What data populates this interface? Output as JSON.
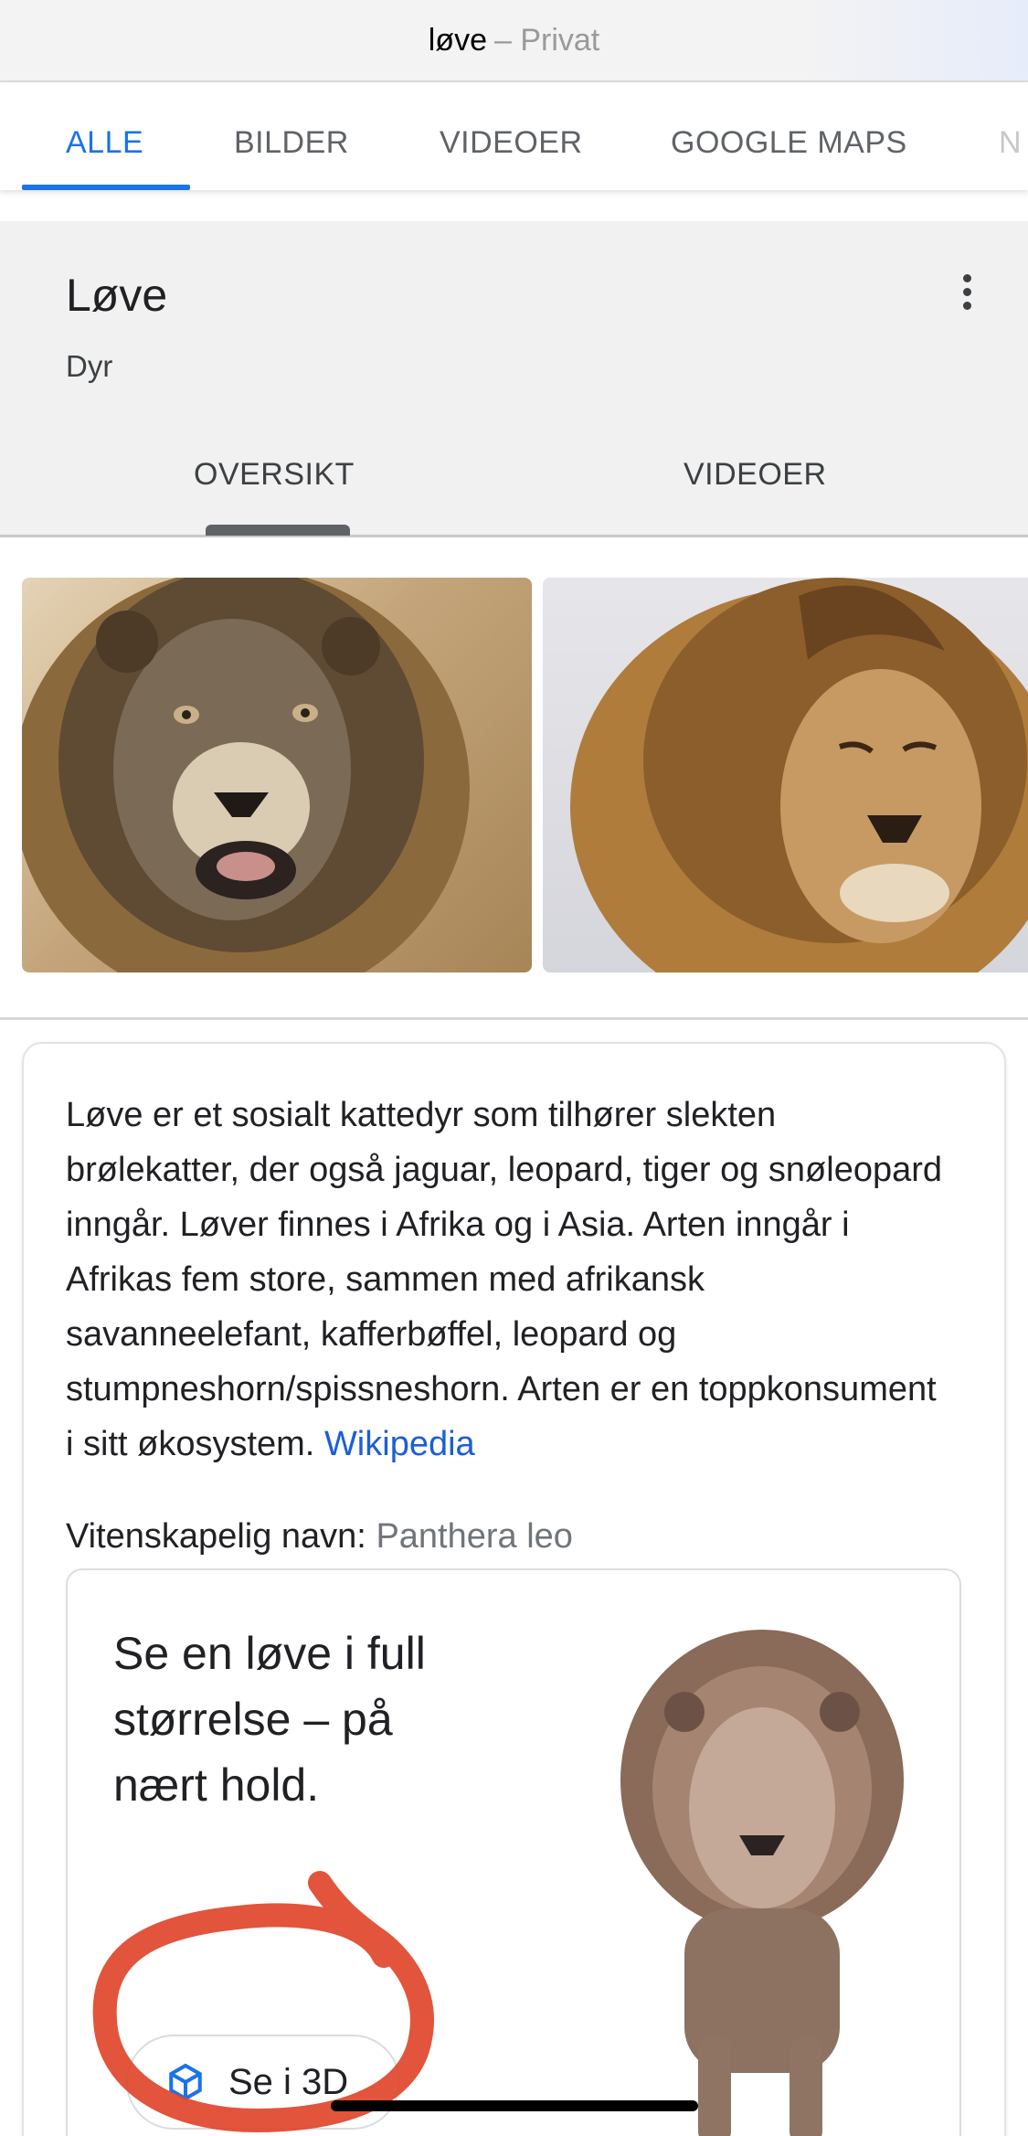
{
  "address_bar": {
    "query": "løve",
    "mode": "– Privat"
  },
  "search_tabs": [
    {
      "label": "ALLE",
      "active": true
    },
    {
      "label": "BILDER",
      "active": false
    },
    {
      "label": "VIDEOER",
      "active": false
    },
    {
      "label": "GOOGLE MAPS",
      "active": false
    },
    {
      "label": "N",
      "active": false
    }
  ],
  "knowledge_panel": {
    "title": "Løve",
    "subtitle": "Dyr",
    "tabs": [
      {
        "label": "OVERSIKT",
        "active": true
      },
      {
        "label": "VIDEOER",
        "active": false
      }
    ]
  },
  "description": {
    "text": "Løve er et sosialt kattedyr som tilhører slekten brølekatter, der også jaguar, leopard, tiger og snøleopard inngår. Løver finnes i Afrika og i Asia. Arten inngår i Afrikas fem store, sammen med afrikansk savanneelefant, kafferbøffel, leopard og stumpneshorn/spissneshorn. Arten er en toppkonsument i sitt økosystem.",
    "source_link": "Wikipedia"
  },
  "scientific_name": {
    "label": "Vitenskapelig navn:",
    "value": "Panthera leo"
  },
  "promo_3d": {
    "text": "Se en løve i full størrelse – på nært hold.",
    "button_label": "Se i 3D"
  },
  "colors": {
    "accent_blue": "#1a73e8",
    "link_blue": "#1a5fd6",
    "annotation_red": "#e0452a"
  }
}
